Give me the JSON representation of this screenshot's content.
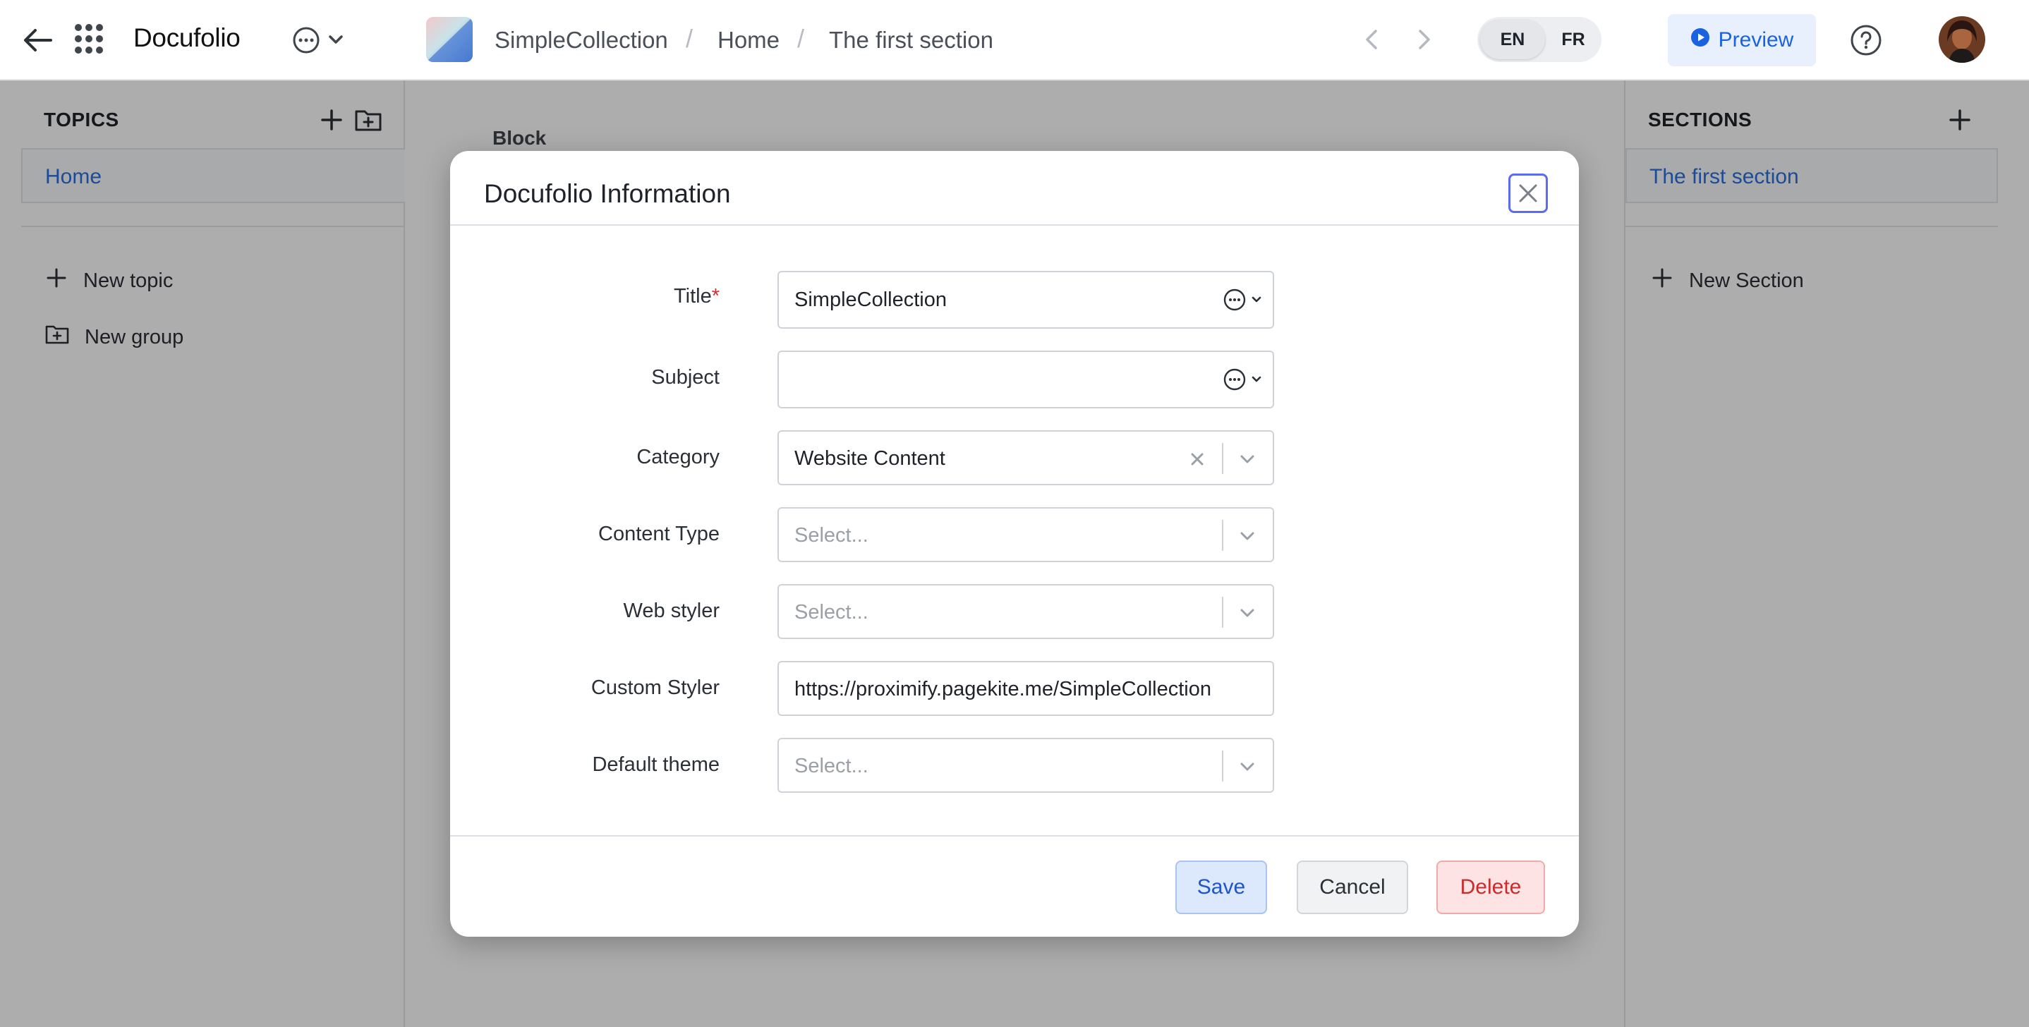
{
  "topbar": {
    "app_name": "Docufolio",
    "breadcrumbs": [
      "SimpleCollection",
      "Home",
      "The first section"
    ],
    "languages": {
      "active": "EN",
      "inactive": "FR"
    },
    "preview_label": "Preview"
  },
  "left_panel": {
    "header": "TOPICS",
    "topics": [
      {
        "label": "Home"
      }
    ],
    "actions": {
      "new_topic": "New topic",
      "new_group": "New group"
    }
  },
  "center": {
    "block_label": "Block"
  },
  "right_panel": {
    "header": "SECTIONS",
    "sections": [
      {
        "label": "The first section"
      }
    ],
    "actions": {
      "new_section": "New Section"
    }
  },
  "modal": {
    "title": "Docufolio Information",
    "fields": {
      "title": {
        "label": "Title",
        "required_mark": "*",
        "value": "SimpleCollection"
      },
      "subject": {
        "label": "Subject",
        "value": ""
      },
      "category": {
        "label": "Category",
        "value": "Website Content"
      },
      "content_type": {
        "label": "Content Type",
        "placeholder": "Select..."
      },
      "web_styler": {
        "label": "Web styler",
        "placeholder": "Select..."
      },
      "custom_styler": {
        "label": "Custom Styler",
        "value": "https://proximify.pagekite.me/SimpleCollection"
      },
      "default_theme": {
        "label": "Default theme",
        "placeholder": "Select..."
      }
    },
    "buttons": {
      "save": "Save",
      "cancel": "Cancel",
      "delete": "Delete"
    }
  },
  "colors": {
    "accent": "#2a6fe0",
    "overlay": "rgba(0,0,0,0.32)",
    "delete": "#cc2b2b",
    "required": "#d32f2f"
  }
}
